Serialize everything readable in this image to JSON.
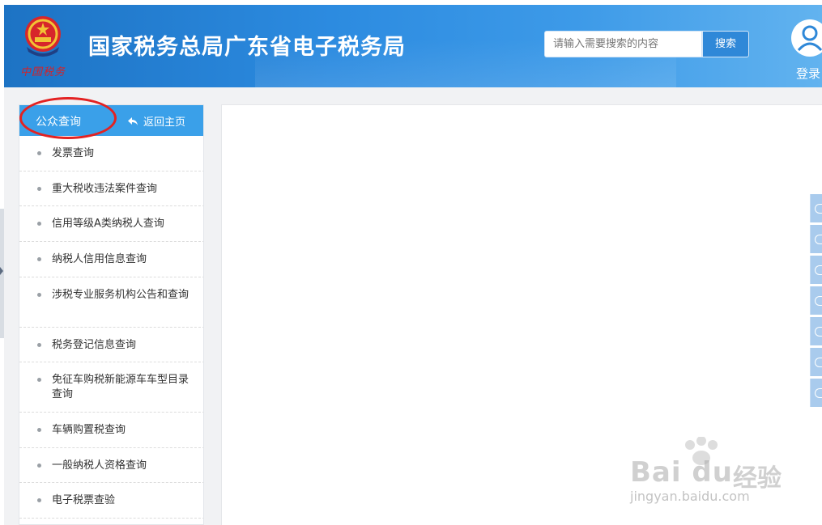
{
  "header": {
    "emblem_caption": "中国税务",
    "site_title": "国家税务总局广东省电子税务局",
    "search_placeholder": "请输入需要搜索的内容",
    "search_button": "搜索",
    "login_label": "登录"
  },
  "sidebar": {
    "title": "公众查询",
    "back_home": "返回主页",
    "items": [
      {
        "label": "发票查询"
      },
      {
        "label": "重大税收违法案件查询"
      },
      {
        "label": "信用等级A类纳税人查询"
      },
      {
        "label": "纳税人信用信息查询"
      },
      {
        "label": "涉税专业服务机构公告和查询"
      },
      {
        "label": "税务登记信息查询"
      },
      {
        "label": "免征车购税新能源车车型目录查询"
      },
      {
        "label": "车辆购置税查询"
      },
      {
        "label": "一般纳税人资格查询"
      },
      {
        "label": "电子税票查验"
      }
    ]
  },
  "icons": {
    "emblem": "national-emblem-icon",
    "user": "user-avatar-icon",
    "back": "back-arrow-icon",
    "tools": [
      "tool-icon",
      "tool-icon",
      "tool-icon",
      "tool-icon",
      "tool-icon",
      "tool-icon",
      "scroll-up-icon"
    ]
  },
  "colors": {
    "header_blue": "#2c8be0",
    "sidebar_head": "#3aa0e9",
    "highlight": "#e32222"
  },
  "watermark": {
    "brand_latin": "Bai du",
    "brand_cn": "经验",
    "url": "jingyan.baidu.com"
  }
}
